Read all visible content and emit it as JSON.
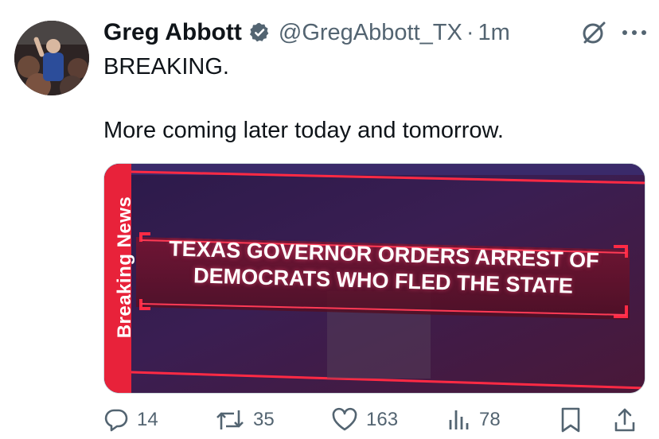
{
  "tweet": {
    "display_name": "Greg Abbott",
    "handle": "@GregAbbott_TX",
    "separator": "·",
    "time": "1m",
    "text_lines": [
      "BREAKING.",
      "",
      "More coming later today and tomorrow."
    ]
  },
  "media": {
    "vertical_tag": "Breaking News",
    "headline_lines": [
      "TEXAS GOVERNOR ORDERS ARREST OF",
      "DEMOCRATS WHO FLED THE STATE"
    ]
  },
  "actions": {
    "replies": "14",
    "retweets": "35",
    "likes": "163",
    "views": "78"
  },
  "icons": {
    "verified": "verified-badge-icon",
    "grok": "grok-icon",
    "more": "more-icon",
    "reply": "reply-icon",
    "retweet": "retweet-icon",
    "like": "heart-icon",
    "views": "views-icon",
    "bookmark": "bookmark-icon",
    "share": "share-icon"
  },
  "colors": {
    "text": "#0f1419",
    "secondary": "#536471",
    "media_red": "#e8223a",
    "media_purple": "#2a1538"
  }
}
